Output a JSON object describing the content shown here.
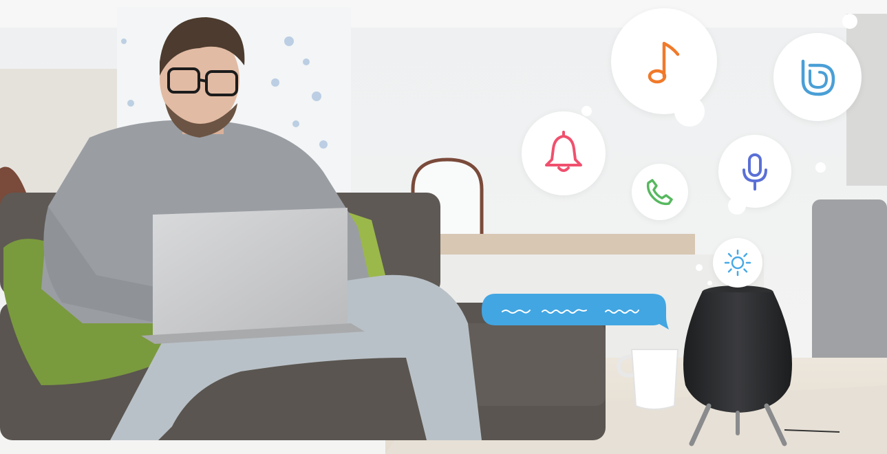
{
  "scene": {
    "description_label": "",
    "colors": {
      "music": "#f07a2a",
      "bixby": "#4a9fd6",
      "bell": "#f0506e",
      "phone": "#57b85f",
      "mic": "#5a6fd6",
      "sun": "#47a9e6",
      "chat": "#42a6e2",
      "speaker": "#2a2b2d"
    },
    "icons": [
      "music-note-icon",
      "bixby-icon",
      "bell-icon",
      "phone-icon",
      "microphone-icon",
      "sun-icon"
    ]
  }
}
